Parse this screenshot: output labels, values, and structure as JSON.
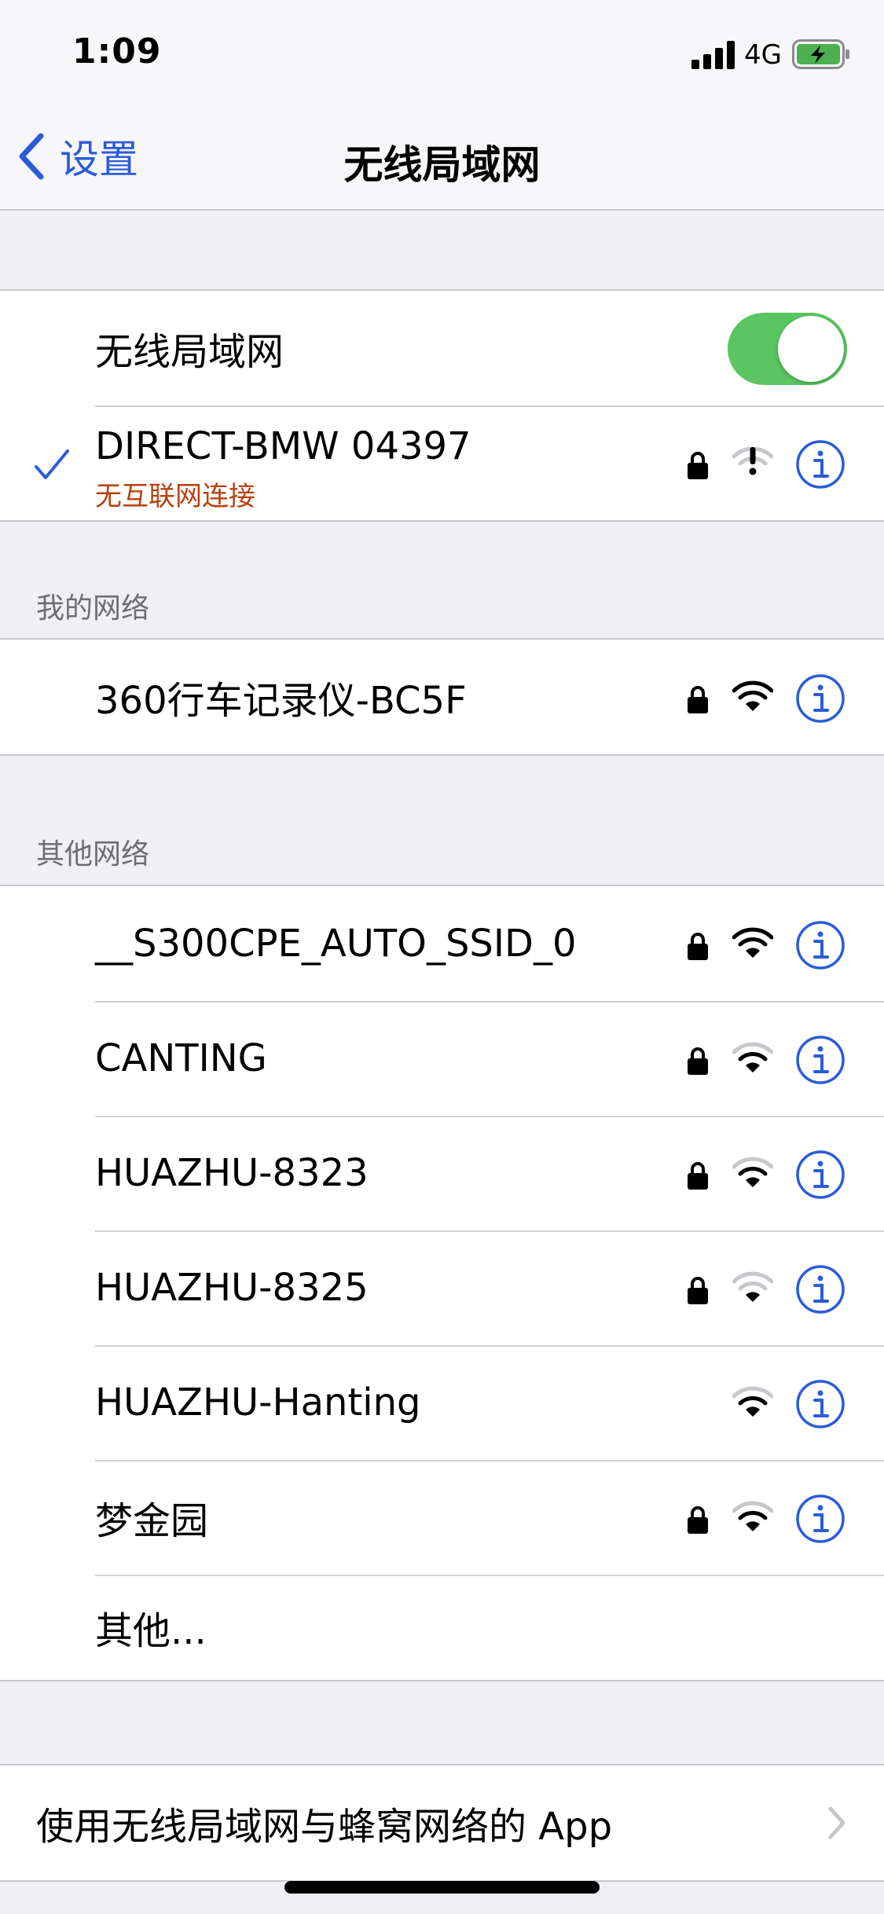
{
  "status": {
    "time": "1:09",
    "network": "4G"
  },
  "nav": {
    "back_label": "设置",
    "title": "无线局域网"
  },
  "wifi_toggle": {
    "label": "无线局域网",
    "on": true
  },
  "current": {
    "name": "DIRECT-BMW 04397",
    "status": "无互联网连接"
  },
  "my_networks": {
    "header": "我的网络",
    "items": [
      {
        "name": "360行车记录仪-BC5F",
        "locked": true
      }
    ]
  },
  "other_networks": {
    "header": "其他网络",
    "items": [
      {
        "name": "__S300CPE_AUTO_SSID_0",
        "locked": true
      },
      {
        "name": "CANTING",
        "locked": true
      },
      {
        "name": "HUAZHU-8323",
        "locked": true
      },
      {
        "name": "HUAZHU-8325",
        "locked": true
      },
      {
        "name": "HUAZHU-Hanting",
        "locked": false
      },
      {
        "name": "梦金园",
        "locked": true
      }
    ],
    "other_label": "其他..."
  },
  "apps_row": {
    "label": "使用无线局域网与蜂窝网络的 App"
  },
  "colors": {
    "accent": "#2b5cd7",
    "toggle_on": "#5ac561",
    "warning": "#b7410e",
    "battery": "#4caf50"
  }
}
